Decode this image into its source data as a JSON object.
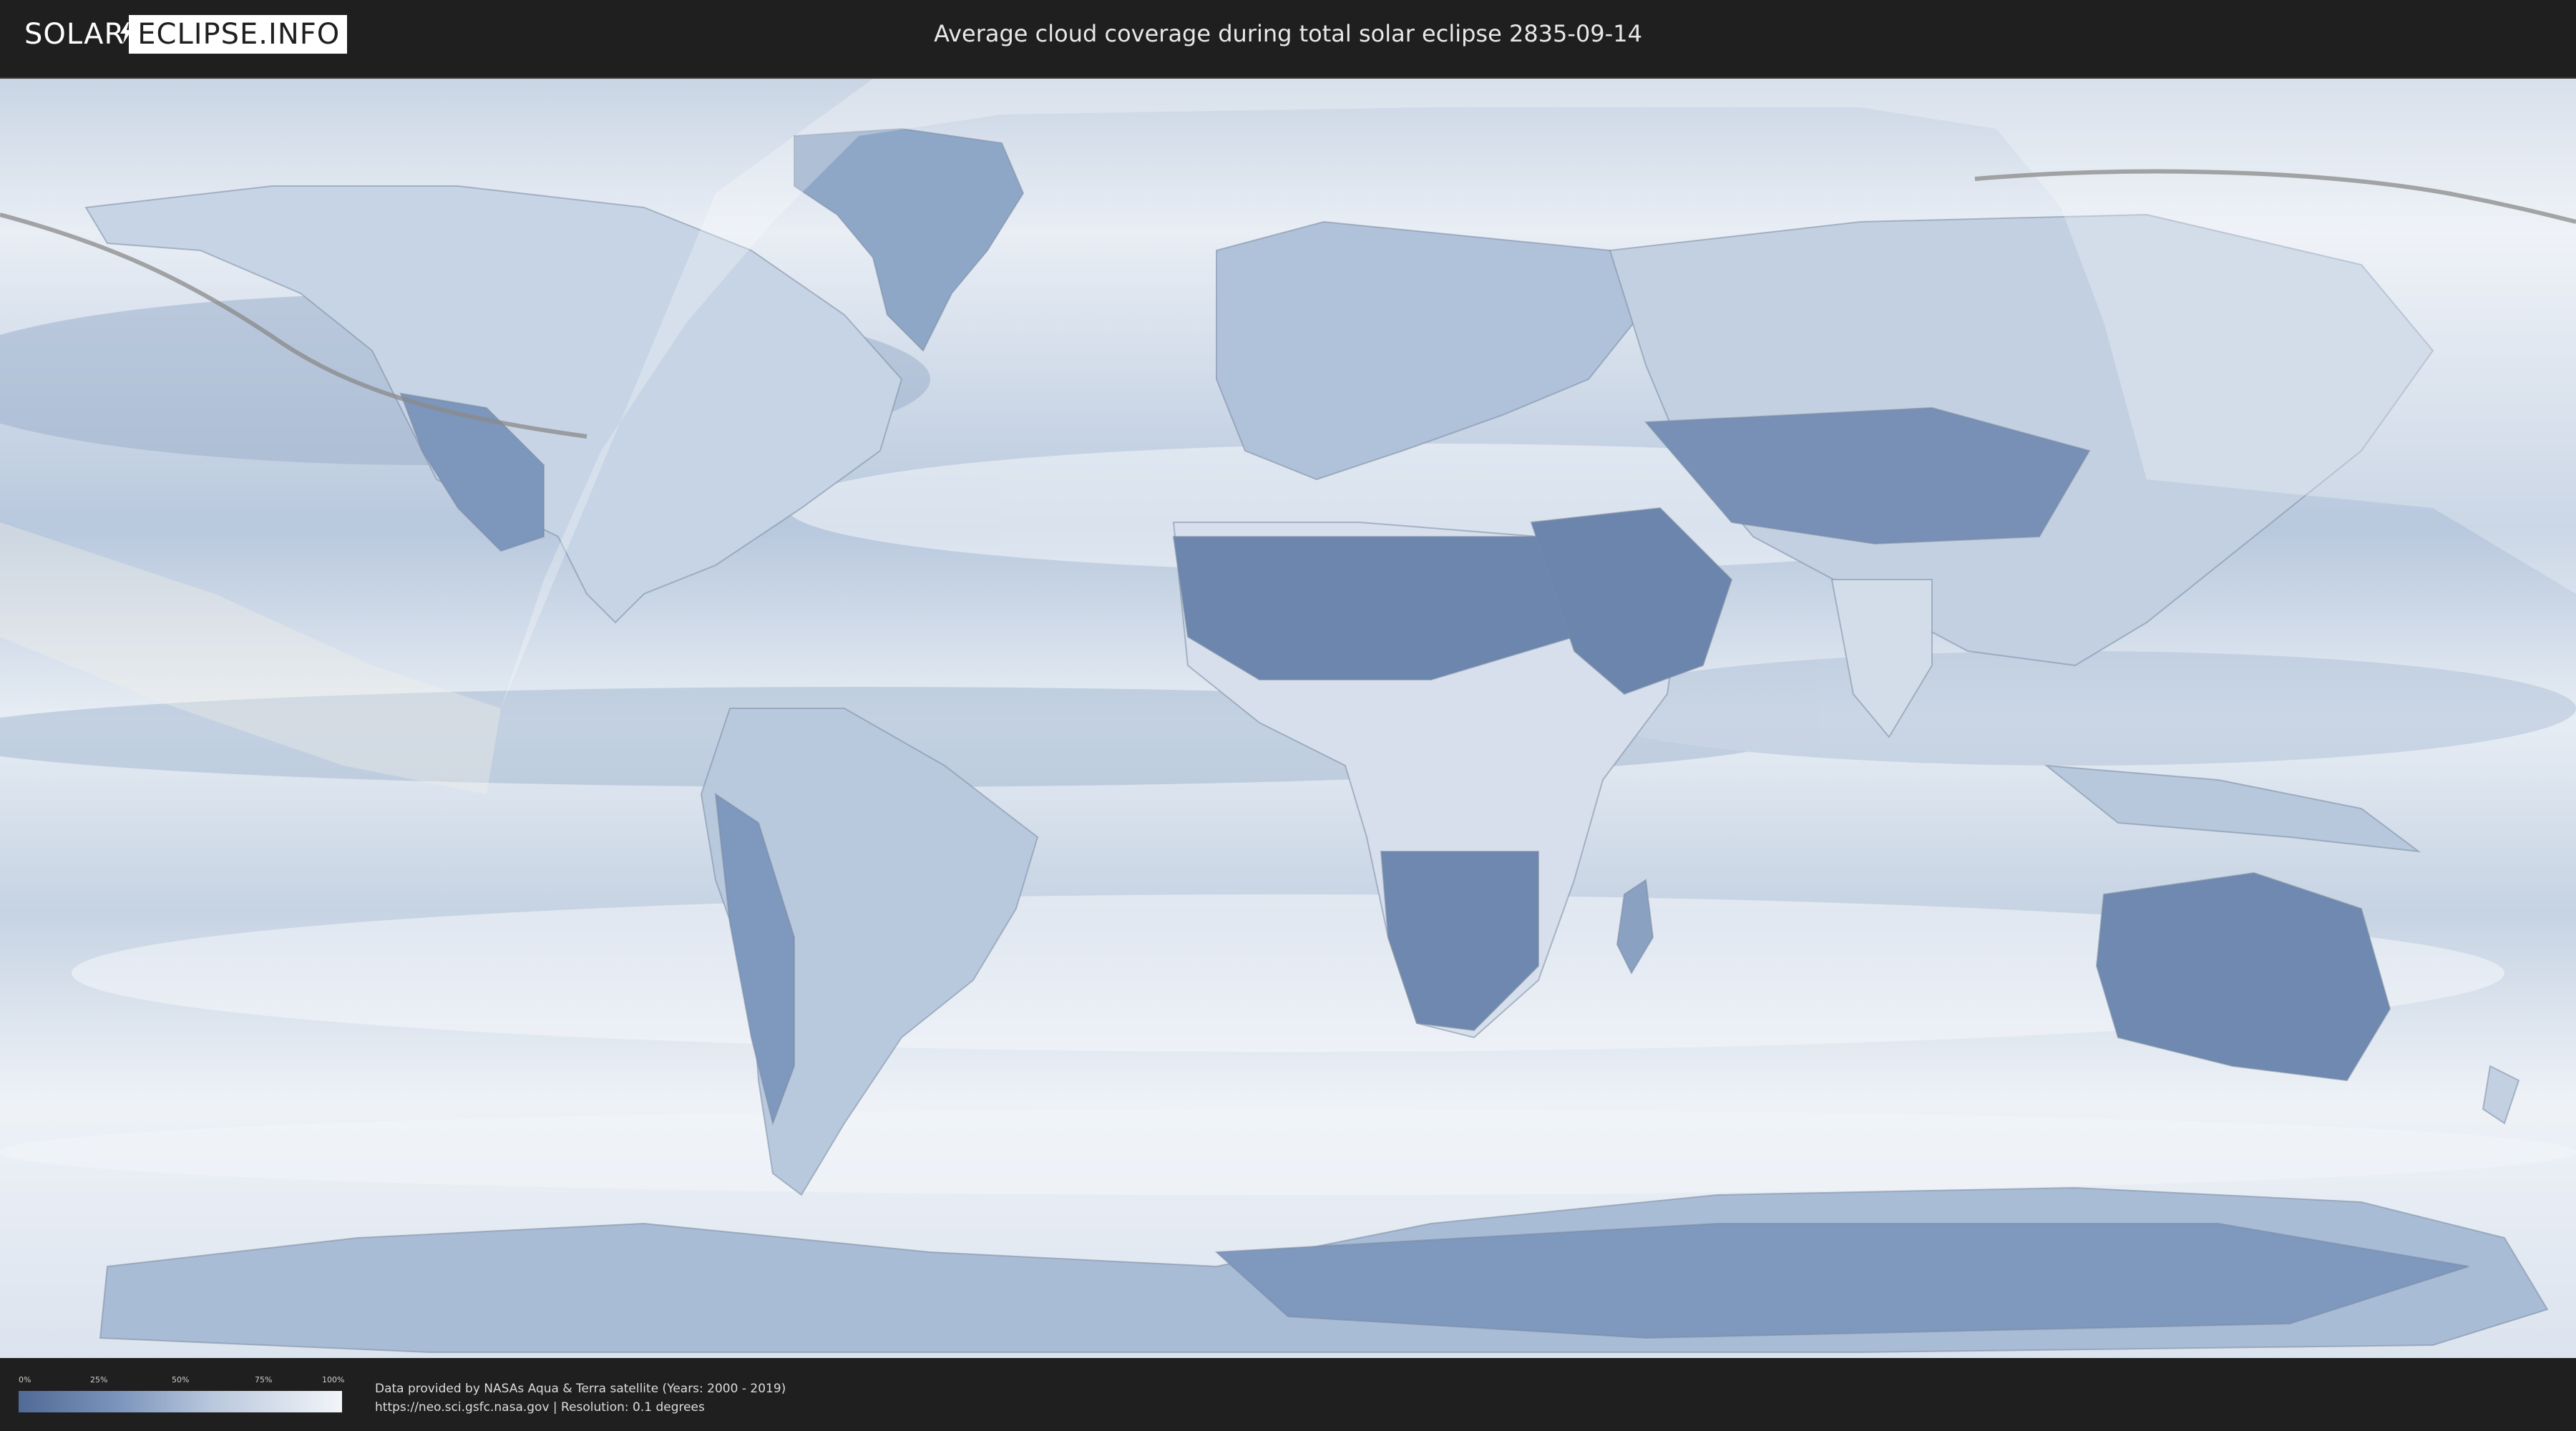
{
  "header": {
    "logo_left": "SOLAR",
    "logo_right": "ECLIPSE.INFO",
    "title": "Average cloud coverage during total solar eclipse 2835-09-14"
  },
  "legend": {
    "ticks": [
      "0%",
      "25%",
      "50%",
      "75%",
      "100%"
    ],
    "color_low": "#506a96",
    "color_high": "#f2f5f9"
  },
  "footer": {
    "credit_line1": "Data provided by NASAs Aqua & Terra satellite (Years: 2000 - 2019)",
    "credit_line2": "https://neo.sci.gsfc.nasa.gov | Resolution: 0.1 degrees"
  },
  "colors": {
    "background": "#1f1f1f",
    "cloud_dense": "#f2f5f9",
    "cloud_sparse": "#506a96",
    "eclipse_path": "#8a8a8a"
  }
}
